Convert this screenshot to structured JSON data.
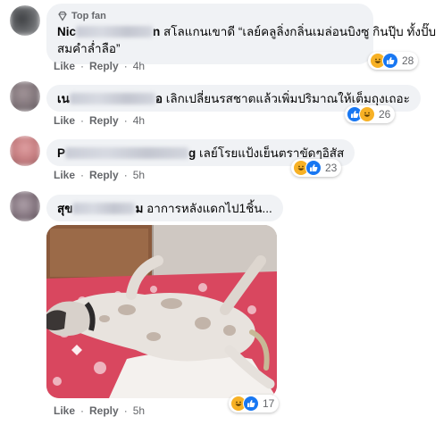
{
  "comments": [
    {
      "badge": "Top fan",
      "name_visible": "Nic",
      "name_tail": "n",
      "text_line1": "สโลแกนเขาดี “เลย์คลูลิ่งกลิ่นเมล่อนบิงซู กินปุ๊บ ทั้งปั๊บ",
      "text_line2": "สมคำล่ำลือ”",
      "like": "Like",
      "reply": "Reply",
      "time": "4h",
      "reactions": "28",
      "avatar_color": "#5d5f62"
    },
    {
      "name_visible": "เน",
      "name_tail": "อ",
      "text": "เลิกเปลี่ยนรสชาตแล้วเพิ่มปริมาณให้เต็มถุงเถอะ",
      "like": "Like",
      "reply": "Reply",
      "time": "4h",
      "reactions": "26",
      "avatar_color": "#8b7f84"
    },
    {
      "name_visible": "P",
      "name_tail": "g",
      "text": "เลย์โรยแป้งเย็นตราขัดๆอิสัส",
      "like": "Like",
      "reply": "Reply",
      "time": "5h",
      "reactions": "23",
      "avatar_color": "#c47b7e"
    },
    {
      "name_visible": "สุข",
      "name_tail": "ม",
      "text": "อาการหลังแดกไป1ชิ้น...",
      "like": "Like",
      "reply": "Reply",
      "time": "5h",
      "reactions": "17",
      "avatar_color": "#7d6e78"
    }
  ],
  "colors": {
    "haha": "#f7b125",
    "like": "#1877f2",
    "bubble": "#f0f2f5",
    "meta": "#65676b"
  },
  "icons": {
    "badge": "diamond-badge-icon",
    "reaction_haha": "haha-emoji-icon",
    "reaction_like": "thumbs-up-icon"
  }
}
